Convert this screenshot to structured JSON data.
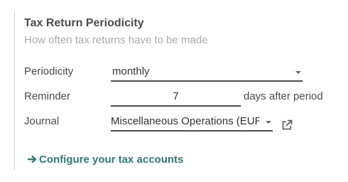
{
  "section": {
    "title": "Tax Return Periodicity",
    "subtitle": "How often tax returns have to be made"
  },
  "fields": {
    "periodicity": {
      "label": "Periodicity",
      "value": "monthly"
    },
    "reminder": {
      "label": "Reminder",
      "value": "7",
      "suffix": "days after period"
    },
    "journal": {
      "label": "Journal",
      "value": "Miscellaneous Operations (EUR)"
    }
  },
  "link": {
    "label": "Configure your tax accounts"
  },
  "colors": {
    "link": "#2e7d77",
    "muted": "#aaaaaa",
    "text": "#4c4c4c"
  },
  "icons": {
    "external": "external-link-icon",
    "arrow": "arrow-right-icon",
    "dropdown": "caret-down-icon"
  }
}
